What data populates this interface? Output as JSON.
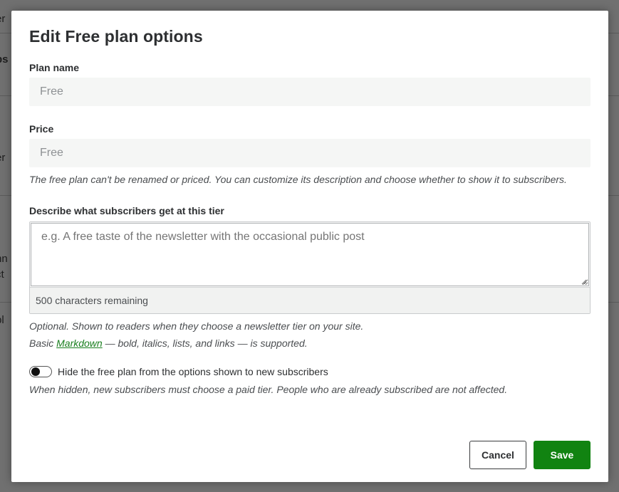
{
  "background": {
    "fragments": [
      "er",
      "bs",
      "er",
      "nn",
      "ct",
      "pl"
    ]
  },
  "modal": {
    "title": "Edit Free plan options",
    "plan_name": {
      "label": "Plan name",
      "value": "Free"
    },
    "price": {
      "label": "Price",
      "value": "Free"
    },
    "free_plan_help": "The free plan can't be renamed or priced. You can customize its description and choose whether to show it to subscribers.",
    "description": {
      "label": "Describe what subscribers get at this tier",
      "placeholder": "e.g. A free taste of the newsletter with the occasional public post",
      "value": "",
      "chars_remaining": "500 characters remaining",
      "help_line1": "Optional. Shown to readers when they choose a newsletter tier on your site.",
      "help_line2_prefix": "Basic ",
      "help_line2_link": "Markdown",
      "help_line2_suffix": " — bold, italics, lists, and links — is supported."
    },
    "hide_toggle": {
      "label": "Hide the free plan from the options shown to new subscribers",
      "checked": false,
      "help": "When hidden, new subscribers must choose a paid tier. People who are already subscribed are not affected."
    },
    "buttons": {
      "cancel": "Cancel",
      "save": "Save"
    }
  },
  "colors": {
    "accent_green": "#118311",
    "link_green": "#1a7f1f",
    "overlay": "#6f7276"
  },
  "icons": {
    "resize_grip": "resize-grip-icon",
    "toggle_knob": "toggle-knob"
  }
}
